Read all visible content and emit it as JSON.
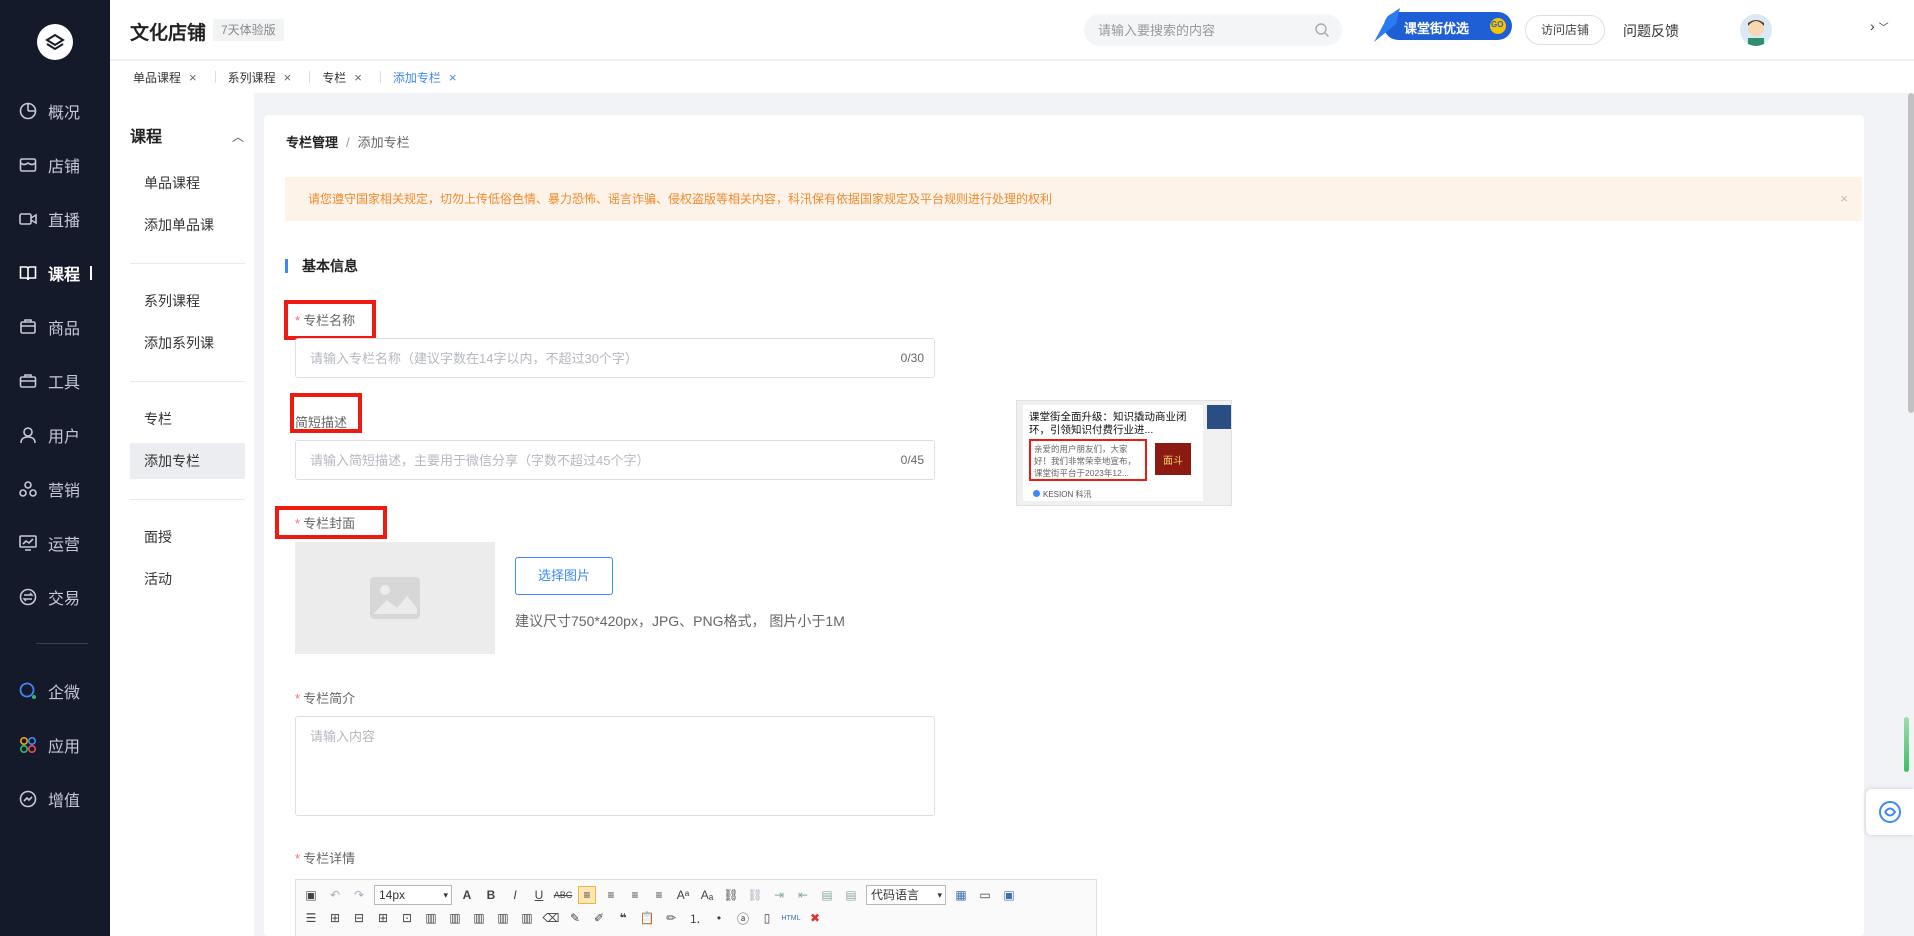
{
  "app": {
    "title": "文化店铺",
    "badge": "7天体验版"
  },
  "rail": {
    "items": [
      "概况",
      "店铺",
      "直播",
      "课程",
      "商品",
      "工具",
      "用户",
      "营销",
      "运营",
      "交易",
      "企微",
      "应用",
      "增值"
    ],
    "active": "课程"
  },
  "topbar": {
    "search_placeholder": "请输入要搜索的内容",
    "promo_label": "课堂街优选",
    "promo_go": "GO",
    "visit_label": "访问店铺",
    "feedback_label": "问题反馈",
    "more": "›"
  },
  "tabs": [
    {
      "label": "单品课程",
      "close": "×"
    },
    {
      "label": "系列课程",
      "close": "×"
    },
    {
      "label": "专栏",
      "close": "×"
    },
    {
      "label": "添加专栏",
      "close": "×"
    }
  ],
  "subnav": {
    "title": "课程",
    "caret": "︿",
    "links": [
      "单品课程",
      "添加单品课",
      "系列课程",
      "添加系列课",
      "专栏",
      "添加专栏",
      "面授",
      "活动"
    ]
  },
  "breadcrumb": {
    "parent": "专栏管理",
    "sep": "/",
    "current": "添加专栏"
  },
  "notice": {
    "text": "请您遵守国家相关规定，切勿上传低俗色情、暴力恐怖、谣言诈骗、侵权盗版等相关内容，科汛保有依据国家规定及平台规则进行处理的权利",
    "close": "×"
  },
  "form": {
    "section_title": "基本信息",
    "name": {
      "label": "专栏名称",
      "required": "*",
      "placeholder": "请输入专栏名称（建议字数在14字以内，不超过30个字）",
      "value": "",
      "counter": "0/30"
    },
    "brief": {
      "label": "简短描述",
      "placeholder": "请输入简短描述，主要用于微信分享（字数不超过45个字）",
      "value": "",
      "counter": "0/45"
    },
    "cover": {
      "label": "专栏封面",
      "required": "*",
      "button": "选择图片",
      "hint": "建议尺寸750*420px，JPG、PNG格式， 图片小于1M"
    },
    "intro": {
      "label": "专栏简介",
      "required": "*",
      "placeholder": "请输入内容"
    },
    "detail": {
      "label": "专栏详情",
      "required": "*",
      "font_size": "14px",
      "code_lang": "代码语言"
    }
  },
  "preview": {
    "title": "课堂街全面升级：知识撬动商业闭环，引领知识付费行业进...",
    "desc": "亲爱的用户朋友们，大家好！我们非常荣幸地宣布，课堂街平台于2023年12...",
    "thumb_text": "面斗",
    "footer": "KESION 科汛"
  },
  "colors": {
    "accent": "#3f88f7",
    "rail_bg": "#151a2b",
    "notice_bg": "#fdf3e8",
    "notice_text": "#f08a2e",
    "required": "#f56c6c",
    "highlight": "#ee1b12"
  }
}
